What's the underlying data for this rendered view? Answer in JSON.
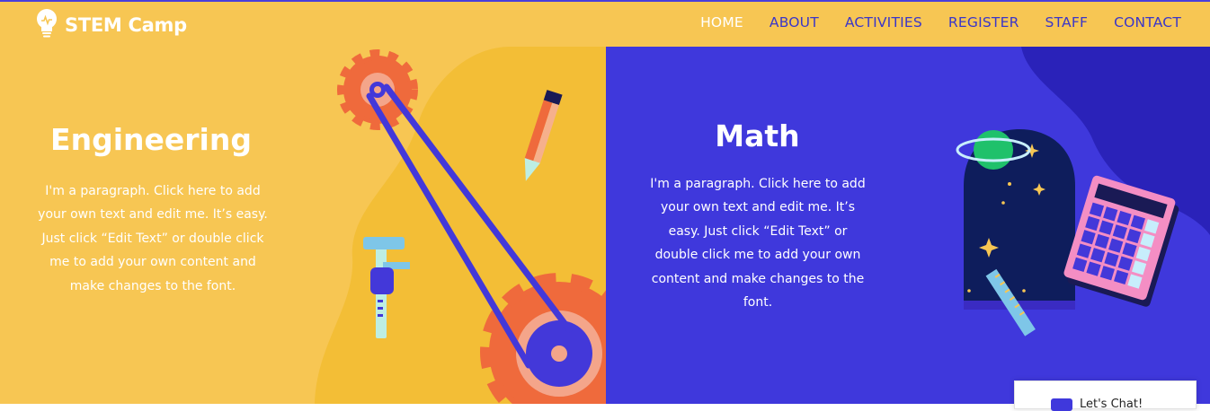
{
  "brand": {
    "name": "STEM Camp",
    "icon": "lightbulb-icon"
  },
  "nav": {
    "items": [
      {
        "label": "HOME",
        "active": true
      },
      {
        "label": "ABOUT",
        "active": false
      },
      {
        "label": "ACTIVITIES",
        "active": false
      },
      {
        "label": "REGISTER",
        "active": false
      },
      {
        "label": "STAFF",
        "active": false
      },
      {
        "label": "CONTACT",
        "active": false
      }
    ]
  },
  "sections": {
    "engineering": {
      "title": "Engineering",
      "paragraph": "I'm a paragraph. Click here to add your own text and edit me. It’s easy. Just click “Edit Text” or double click me to add your own content and make changes to the font."
    },
    "math": {
      "title": "Math",
      "paragraph": "I'm a paragraph. Click here to add your own text and edit me. It’s easy. Just click “Edit Text” or double click me to add your own content and make changes to the font."
    }
  },
  "chat": {
    "label": "Let's Chat!",
    "icon": "chat-bubble-icon"
  },
  "colors": {
    "yellow": "#f7c653",
    "yellow_dark": "#f3be36",
    "blue": "#3f38dc",
    "blue_dark": "#2a22b9",
    "orange": "#ef6a3c",
    "navy": "#0e1d5c",
    "pink": "#f48ec4",
    "green": "#1fc16b"
  }
}
